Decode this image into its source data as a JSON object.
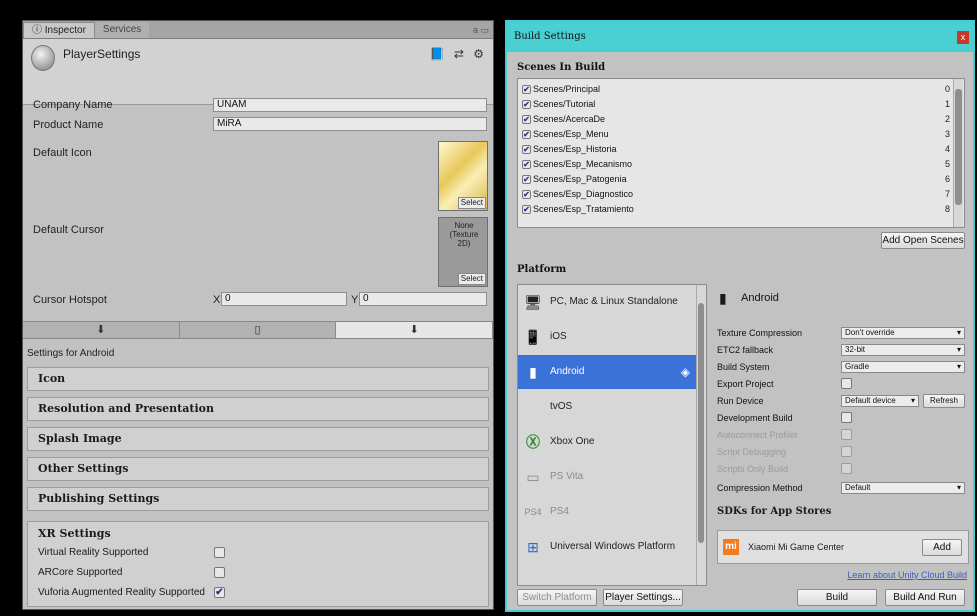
{
  "inspector": {
    "tabs": [
      "Inspector",
      "Services"
    ],
    "tab_tools": "a ▭",
    "title": "PlayerSettings",
    "header_icons": "📘 ⇄ ⚙",
    "company_label": "Company Name",
    "company_value": "UNAM",
    "product_label": "Product Name",
    "product_value": "MiRA",
    "default_icon_label": "Default Icon",
    "default_cursor_label": "Default Cursor",
    "cursor_preview": "None\n(Texture\n2D)",
    "select_label": "Select",
    "hotspot_label": "Cursor Hotspot",
    "hotspot_x_label": "X",
    "hotspot_x": "0",
    "hotspot_y_label": "Y",
    "hotspot_y": "0",
    "platform_tab_glyphs": [
      "⬇",
      "▯",
      "⬇"
    ],
    "settings_for": "Settings for Android",
    "sections": [
      "Icon",
      "Resolution and Presentation",
      "Splash Image",
      "Other Settings",
      "Publishing Settings"
    ],
    "xr": {
      "title": "XR Settings",
      "items": [
        {
          "label": "Virtual Reality Supported",
          "checked": false
        },
        {
          "label": "ARCore Supported",
          "checked": false
        },
        {
          "label": "Vuforia Augmented Reality Supported",
          "checked": true
        }
      ]
    }
  },
  "build": {
    "title": "Build Settings",
    "close": "x",
    "scenes_header": "Scenes In Build",
    "scenes": [
      {
        "name": "Scenes/Principal",
        "index": "0"
      },
      {
        "name": "Scenes/Tutorial",
        "index": "1"
      },
      {
        "name": "Scenes/AcercaDe",
        "index": "2"
      },
      {
        "name": "Scenes/Esp_Menu",
        "index": "3"
      },
      {
        "name": "Scenes/Esp_Historia",
        "index": "4"
      },
      {
        "name": "Scenes/Esp_Mecanismo",
        "index": "5"
      },
      {
        "name": "Scenes/Esp_Patogenia",
        "index": "6"
      },
      {
        "name": "Scenes/Esp_Diagnostico",
        "index": "7"
      },
      {
        "name": "Scenes/Esp_Tratamiento",
        "index": "8"
      }
    ],
    "add_open_scenes": "Add Open Scenes",
    "platform_header": "Platform",
    "platforms": [
      {
        "name": "PC, Mac & Linux Standalone",
        "icon": "pc-icon"
      },
      {
        "name": "iOS",
        "icon": "ios-icon"
      },
      {
        "name": "Android",
        "icon": "android-icon"
      },
      {
        "name": "tvOS",
        "icon": "apple-tv-icon"
      },
      {
        "name": "Xbox One",
        "icon": "xbox-icon"
      },
      {
        "name": "PS Vita",
        "icon": "ps-vita-icon"
      },
      {
        "name": "PS4",
        "icon": "ps4-icon"
      },
      {
        "name": "Universal Windows Platform",
        "icon": "windows-icon"
      }
    ],
    "selected_platform": "Android",
    "options": [
      {
        "label": "Texture Compression",
        "value": "Don't override"
      },
      {
        "label": "ETC2 fallback",
        "value": "32-bit"
      },
      {
        "label": "Build System",
        "value": "Gradle"
      },
      {
        "label": "Export Project",
        "value": ""
      },
      {
        "label": "Run Device",
        "value": "Default device"
      },
      {
        "label": "Development Build",
        "value": ""
      },
      {
        "label": "Autoconnect Profiler",
        "value": ""
      },
      {
        "label": "Script Debugging",
        "value": ""
      },
      {
        "label": "Scripts Only Build",
        "value": ""
      },
      {
        "label": "Compression Method",
        "value": "Default"
      }
    ],
    "refresh": "Refresh",
    "sdk_header": "SDKs for App Stores",
    "sdk_name": "Xiaomi Mi Game Center",
    "sdk_add": "Add",
    "cloud_link": "Learn about Unity Cloud Build",
    "switch_platform": "Switch Platform",
    "player_settings": "Player Settings...",
    "build_btn": "Build",
    "build_and_run": "Build And Run"
  },
  "colors": {
    "accent_titlebar": "#4ad0d2",
    "selection": "#3a72d8",
    "link": "#3a5fc4"
  }
}
